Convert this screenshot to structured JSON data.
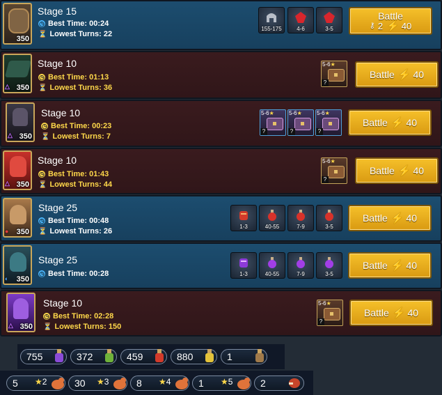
{
  "colors": {
    "accent_gold": "#f5c02a",
    "energy": "#ffeb3b",
    "blue_row": "#1c4d6f",
    "dark_row": "#3a1b1e"
  },
  "stages": [
    {
      "title": "Stage 15",
      "level": "350",
      "best_time_label": "Best Time: 00:24",
      "turns_label": "Lowest Turns: 22",
      "drops": [
        {
          "icon": "helmet-icon",
          "range": "155-175"
        },
        {
          "icon": "red-gem-icon",
          "range": "4-6"
        },
        {
          "icon": "red-gem-icon",
          "range": "3-5"
        }
      ],
      "button": {
        "label": "Battle",
        "keys": "2",
        "energy": "40"
      }
    },
    {
      "title": "Stage 10",
      "level": "350",
      "affinity": "△",
      "best_time_label": "Best Time: 01:13",
      "turns_label": "Lowest Turns: 36",
      "chests": [
        {
          "range": "5-6",
          "star": "★",
          "q": "?"
        }
      ],
      "button": {
        "label": "Battle",
        "energy": "40"
      }
    },
    {
      "title": "Stage 10",
      "level": "350",
      "affinity": "△",
      "best_time_label": "Best Time: 00:23",
      "turns_label": "Lowest Turns: 7",
      "chests": [
        {
          "range": "5-6",
          "star": "★",
          "q": "?"
        },
        {
          "range": "5-6",
          "star": "★",
          "q": "?"
        },
        {
          "range": "5-6",
          "star": "★",
          "q": "?"
        }
      ],
      "button": {
        "label": "Battle",
        "energy": "40"
      }
    },
    {
      "title": "Stage 10",
      "level": "350",
      "affinity": "△",
      "best_time_label": "Best Time: 01:43",
      "turns_label": "Lowest Turns: 44",
      "chests": [
        {
          "range": "5-6",
          "star": "★",
          "q": "?"
        }
      ],
      "button": {
        "label": "Battle",
        "energy": "40"
      }
    },
    {
      "title": "Stage 25",
      "level": "350",
      "best_time_label": "Best Time: 00:48",
      "turns_label": "Lowest Turns: 26",
      "drops": [
        {
          "icon": "red-scroll-icon",
          "range": "1-3"
        },
        {
          "icon": "red-potion-icon",
          "range": "40-55"
        },
        {
          "icon": "red-potion-icon",
          "range": "7-9"
        },
        {
          "icon": "red-potion-icon",
          "range": "3-5"
        }
      ],
      "button": {
        "label": "Battle",
        "energy": "40"
      }
    },
    {
      "title": "Stage 25",
      "level": "350",
      "best_time_label": "Best Time: 00:28",
      "drops": [
        {
          "icon": "purple-scroll-icon",
          "range": "1-3"
        },
        {
          "icon": "purple-potion-icon",
          "range": "40-55"
        },
        {
          "icon": "purple-potion-icon",
          "range": "7-9"
        },
        {
          "icon": "purple-potion-icon",
          "range": "3-5"
        }
      ],
      "button": {
        "label": "Battle",
        "energy": "40"
      }
    },
    {
      "title": "Stage 10",
      "level": "350",
      "affinity": "△",
      "best_time_label": "Best Time: 02:28",
      "turns_label": "Lowest Turns: 150",
      "chests": [
        {
          "range": "5-6",
          "star": "★",
          "q": "?"
        }
      ],
      "button": {
        "label": "Battle",
        "energy": "40"
      }
    }
  ],
  "inventory_potions": [
    {
      "value": "755",
      "icon": "purple-potion-icon"
    },
    {
      "value": "372",
      "icon": "green-potion-icon"
    },
    {
      "value": "459",
      "icon": "red-potion-icon"
    },
    {
      "value": "880",
      "icon": "yellow-potion-icon"
    },
    {
      "value": "1",
      "icon": "brown-potion-icon"
    }
  ],
  "inventory_chickens": [
    {
      "value": "5",
      "stars": "2"
    },
    {
      "value": "30",
      "stars": "3"
    },
    {
      "value": "8",
      "stars": "4"
    },
    {
      "value": "1",
      "stars": "5"
    },
    {
      "value": "2",
      "icon": "meat-icon"
    }
  ]
}
